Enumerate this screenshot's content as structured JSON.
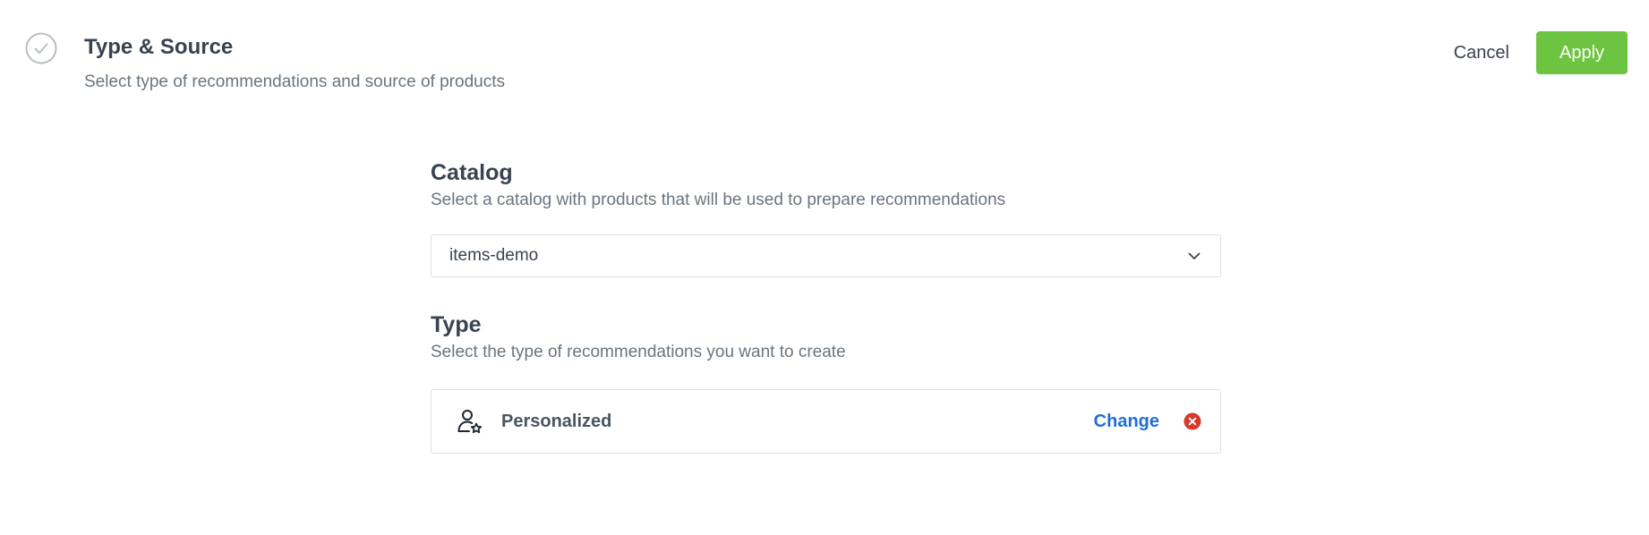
{
  "header": {
    "title": "Type & Source",
    "subtitle": "Select type of recommendations and source of products",
    "step_icon": "check-circle-icon",
    "cancel_label": "Cancel",
    "apply_label": "Apply"
  },
  "catalog": {
    "title": "Catalog",
    "description": "Select a catalog with products that will be used to prepare recommendations",
    "selected_value": "items-demo",
    "dropdown_icon": "chevron-down-icon"
  },
  "type": {
    "title": "Type",
    "description": "Select the type of recommendations you want to create",
    "selected": {
      "label": "Personalized",
      "icon": "person-star-icon",
      "change_label": "Change",
      "remove_icon": "remove-circle-icon"
    }
  },
  "colors": {
    "apply_button": "#6dc440",
    "link": "#1f6fd6",
    "remove": "#d8372c",
    "border": "#dbe0e5"
  }
}
